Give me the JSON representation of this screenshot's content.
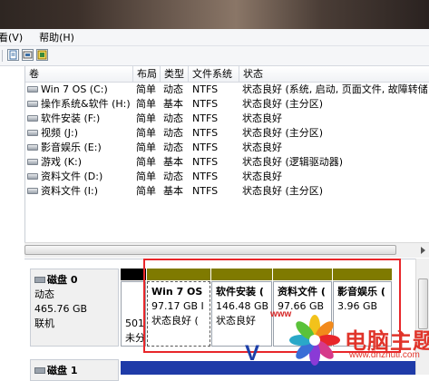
{
  "menu": [
    "看(V)",
    "帮助(H)"
  ],
  "toolbar": {
    "icons": [
      "properties-icon",
      "help-topic-icon",
      "volume-icon"
    ]
  },
  "columns": [
    "卷",
    "布局",
    "类型",
    "文件系统",
    "状态"
  ],
  "volumes": [
    {
      "name": "Win 7 OS  (C:)",
      "layout": "简单",
      "type": "动态",
      "fs": "NTFS",
      "status": "状态良好 (系统, 启动, 页面文件, 故障转储"
    },
    {
      "name": "操作系统&软件 (H:)",
      "layout": "简单",
      "type": "基本",
      "fs": "NTFS",
      "status": "状态良好 (主分区)"
    },
    {
      "name": "软件安装 (F:)",
      "layout": "简单",
      "type": "动态",
      "fs": "NTFS",
      "status": "状态良好"
    },
    {
      "name": "视频 (J:)",
      "layout": "简单",
      "type": "动态",
      "fs": "NTFS",
      "status": "状态良好 (主分区)"
    },
    {
      "name": "影音娱乐 (E:)",
      "layout": "简单",
      "type": "动态",
      "fs": "NTFS",
      "status": "状态良好"
    },
    {
      "name": "游戏 (K:)",
      "layout": "简单",
      "type": "基本",
      "fs": "NTFS",
      "status": "状态良好 (逻辑驱动器)"
    },
    {
      "name": "资料文件 (D:)",
      "layout": "简单",
      "type": "动态",
      "fs": "NTFS",
      "status": "状态良好"
    },
    {
      "name": "资料文件 (I:)",
      "layout": "简单",
      "type": "基本",
      "fs": "NTFS",
      "status": "状态良好 (主分区)"
    }
  ],
  "disk0": {
    "name": "磁盘 0",
    "type": "动态",
    "size": "465.76 GB",
    "status": "联机"
  },
  "disk1": {
    "name": "磁盘 1"
  },
  "partitions": [
    {
      "name": "",
      "size": "501",
      "status": "未分",
      "head_color": "#000000"
    },
    {
      "name": "Win 7 OS",
      "size": "97.17 GB I",
      "status": "状态良好 (",
      "head_color": "#7f7a00"
    },
    {
      "name": "软件安装 (",
      "size": "146.48 GB",
      "status": "状态良好",
      "head_color": "#7f7a00"
    },
    {
      "name": "资料文件 (",
      "size": "97.66 GB",
      "status": "",
      "head_color": "#7f7a00"
    },
    {
      "name": "影音娱乐 (",
      "size": "3.96 GB",
      "status": "",
      "head_color": "#7f7a00"
    }
  ],
  "watermark": {
    "site": "电脑主题",
    "url": "www.dnzhuti.com",
    "tag": "www"
  },
  "colors": {
    "highlight_box": "#e8262a",
    "dynamic_volume": "#7f7a00",
    "disk1_bar": "#1f3ba8"
  }
}
